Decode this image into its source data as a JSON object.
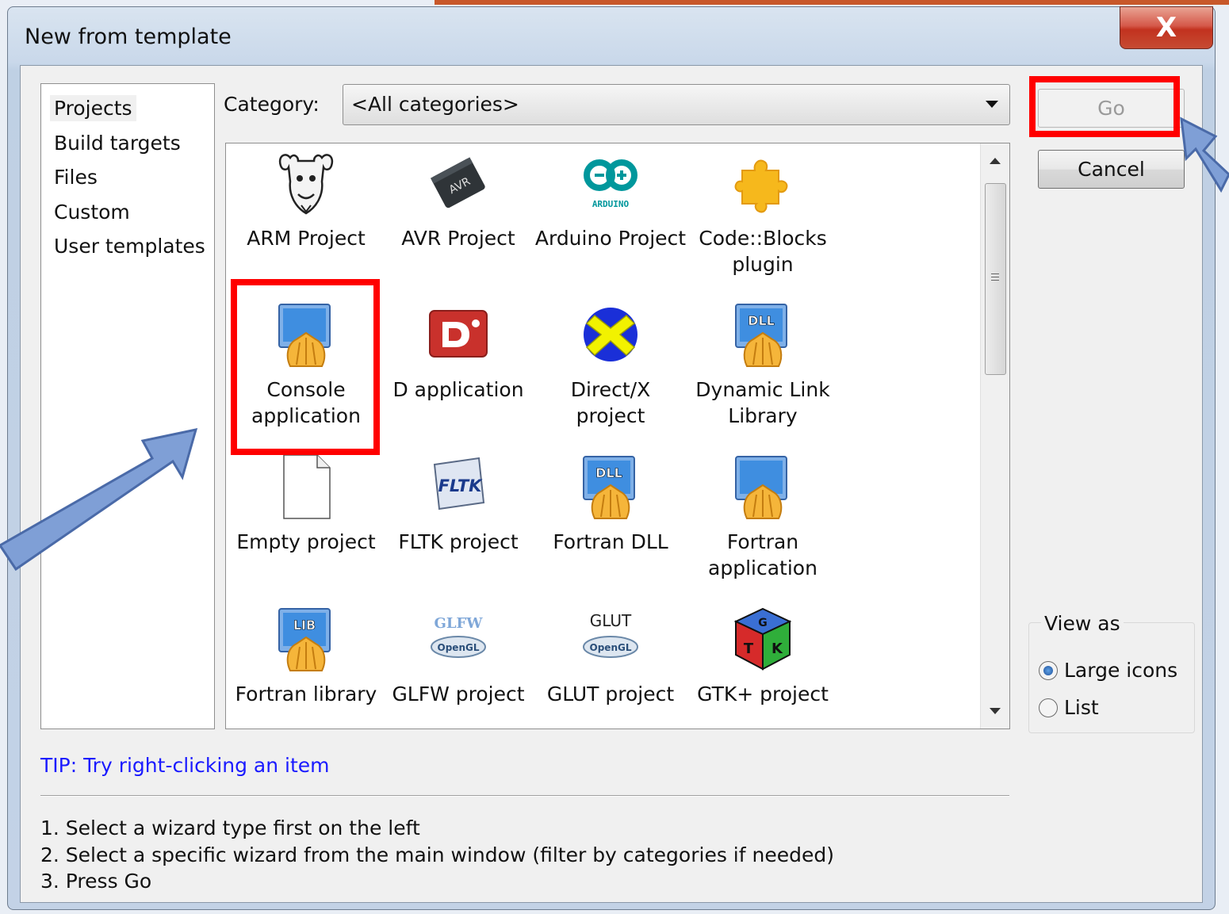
{
  "window": {
    "title": "New from template",
    "close_glyph": "X"
  },
  "left_list": {
    "items": [
      {
        "label": "Projects",
        "selected": true
      },
      {
        "label": "Build targets",
        "selected": false
      },
      {
        "label": "Files",
        "selected": false
      },
      {
        "label": "Custom",
        "selected": false
      },
      {
        "label": "User templates",
        "selected": false
      }
    ]
  },
  "category": {
    "label": "Category:",
    "value": "<All categories>"
  },
  "templates": [
    {
      "label": "ARM Project",
      "icon": "gnu-icon"
    },
    {
      "label": "AVR Project",
      "icon": "avr-chip-icon",
      "icon_text": "AVR"
    },
    {
      "label": "Arduino Project",
      "icon": "arduino-icon",
      "icon_text": "ARDUINO"
    },
    {
      "label": "Code::Blocks plugin",
      "icon": "puzzle-icon"
    },
    {
      "label": "Console application",
      "icon": "console-app-icon"
    },
    {
      "label": "D application",
      "icon": "d-language-icon"
    },
    {
      "label": "Direct/X project",
      "icon": "directx-icon"
    },
    {
      "label": "Dynamic Link Library",
      "icon": "dll-icon",
      "icon_text": "DLL"
    },
    {
      "label": "Empty project",
      "icon": "blank-page-icon"
    },
    {
      "label": "FLTK project",
      "icon": "fltk-icon",
      "icon_text": "FLTK"
    },
    {
      "label": "Fortran DLL",
      "icon": "dll-icon",
      "icon_text": "DLL"
    },
    {
      "label": "Fortran application",
      "icon": "console-app-icon"
    },
    {
      "label": "Fortran library",
      "icon": "lib-icon",
      "icon_text": "LIB"
    },
    {
      "label": "GLFW project",
      "icon": "glfw-opengl-icon",
      "icon_text": "GLFW"
    },
    {
      "label": "GLUT project",
      "icon": "glut-opengl-icon",
      "icon_text": "GLUT"
    },
    {
      "label": "GTK+ project",
      "icon": "gtk-cube-icon"
    }
  ],
  "opengl_badge_text": "OpenGL",
  "buttons": {
    "go": "Go",
    "cancel": "Cancel"
  },
  "view_as": {
    "legend": "View as",
    "options": [
      {
        "label": "Large icons",
        "checked": true
      },
      {
        "label": "List",
        "checked": false
      }
    ]
  },
  "tip": "TIP: Try right-clicking an item",
  "instructions": [
    "1. Select a wizard type first on the left",
    "2. Select a specific wizard from the main window (filter by categories if needed)",
    "3. Press Go"
  ],
  "colors": {
    "highlight": "#ff0000",
    "annotation_arrow": "#7f9fd6",
    "tip_text": "#1a1aff"
  }
}
